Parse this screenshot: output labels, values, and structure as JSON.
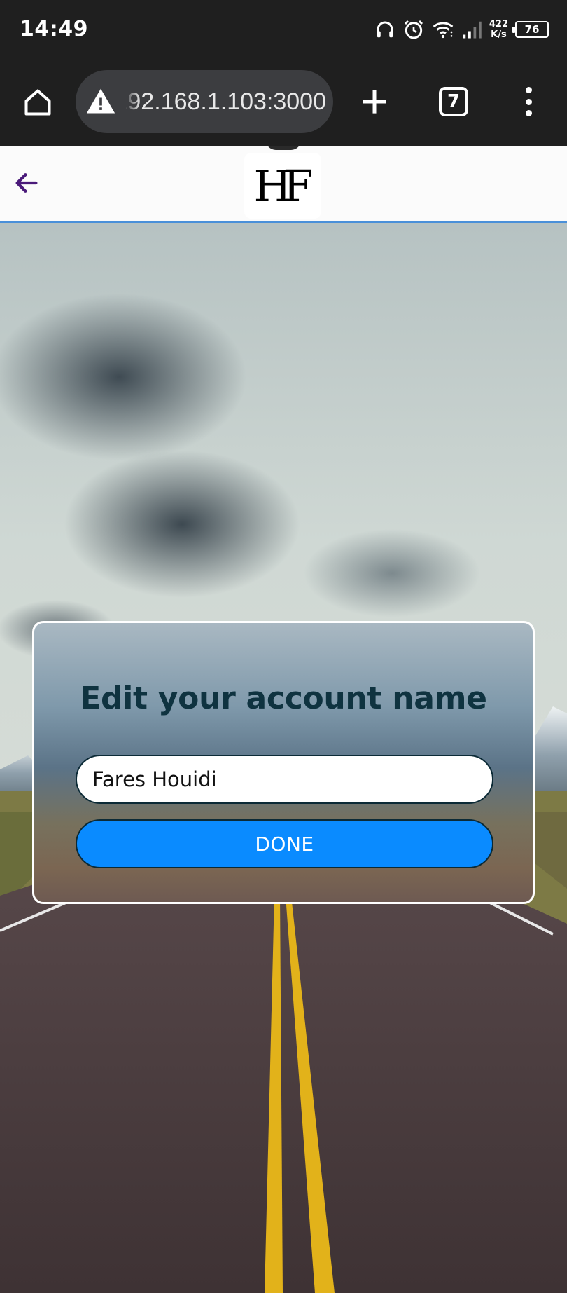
{
  "status_bar": {
    "time": "14:49",
    "net_speed_value": "422",
    "net_speed_unit": "K/s",
    "battery": "76",
    "icons": [
      "headphones-icon",
      "alarm-icon",
      "wifi-icon",
      "signal-icon"
    ]
  },
  "browser": {
    "url": "192.168.1.103:3000",
    "tab_count": "7",
    "icons": [
      "home-icon",
      "warning-icon",
      "plus-icon",
      "more-vert-icon"
    ]
  },
  "header": {
    "logo_text": "HF",
    "back_icon": "arrow-back-icon",
    "accent_color": "#4a1a7a",
    "border_color": "#4a90d9"
  },
  "dialog": {
    "title": "Edit your account name",
    "name_value": "Fares Houidi",
    "done_label": "DONE",
    "button_color": "#0a8bff",
    "title_color": "#0f3340"
  }
}
